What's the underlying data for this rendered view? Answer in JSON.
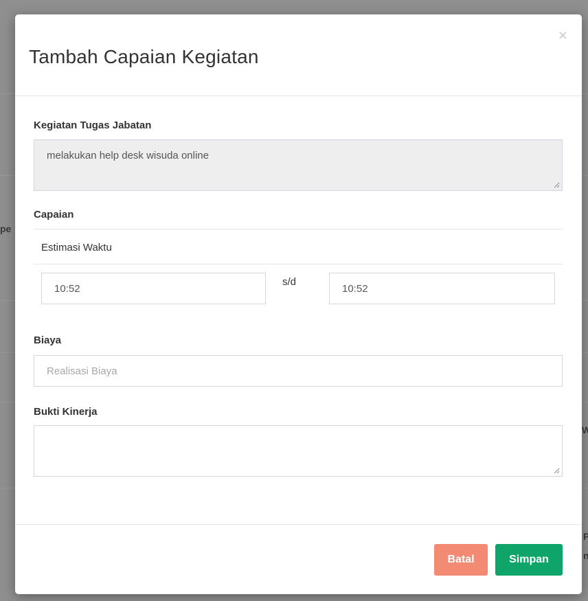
{
  "background": {
    "fragment_left": "pe",
    "fragment_right_1": "Wa",
    "fragment_right_2": "P",
    "fragment_right_3": "n"
  },
  "modal": {
    "title": "Tambah Capaian Kegiatan",
    "close_label": "×"
  },
  "form": {
    "kegiatan": {
      "label": "Kegiatan Tugas Jabatan",
      "value": "melakukan help desk wisuda online"
    },
    "capaian": {
      "label": "Capaian",
      "estimasi_label": "Estimasi Waktu",
      "start_time": "10:52",
      "separator": "s/d",
      "end_time": "10:52"
    },
    "biaya": {
      "label": "Biaya",
      "value": "",
      "placeholder": "Realisasi Biaya"
    },
    "bukti": {
      "label": "Bukti Kinerja",
      "value": ""
    }
  },
  "footer": {
    "cancel_label": "Batal",
    "save_label": "Simpan"
  },
  "colors": {
    "cancel": "#f38a73",
    "save": "#0fa46a",
    "readonly_bg": "#eeeeee",
    "backdrop": "#8f8f8f"
  }
}
